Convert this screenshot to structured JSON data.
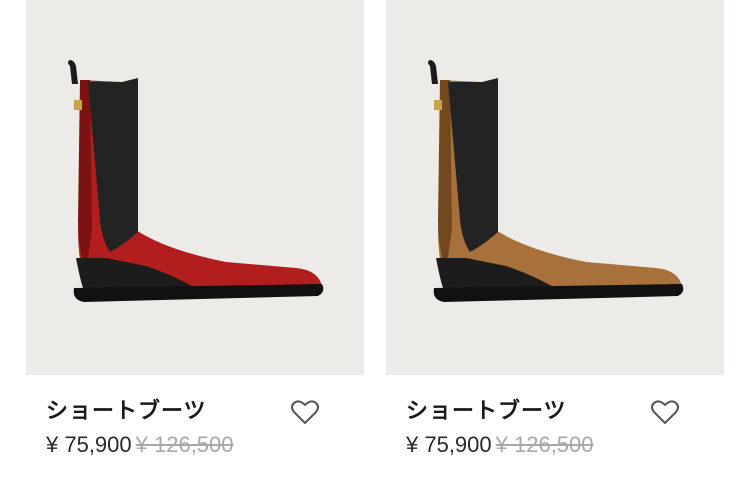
{
  "products": [
    {
      "name": "ショートブーツ",
      "price": "¥ 75,900",
      "original_price": "¥ 126,500",
      "boot_color": "#b21e1e",
      "boot_shade": "#7d1212",
      "image_alt": "red chelsea boot",
      "favorite_icon": "heart-outline-icon"
    },
    {
      "name": "ショートブーツ",
      "price": "¥ 75,900",
      "original_price": "¥ 126,500",
      "boot_color": "#a8713c",
      "boot_shade": "#74481f",
      "image_alt": "tan chelsea boot",
      "favorite_icon": "heart-outline-icon"
    }
  ],
  "colors": {
    "image_background": "#ecebe8",
    "text": "#1a1a1a",
    "strike": "#a8a8a8"
  }
}
